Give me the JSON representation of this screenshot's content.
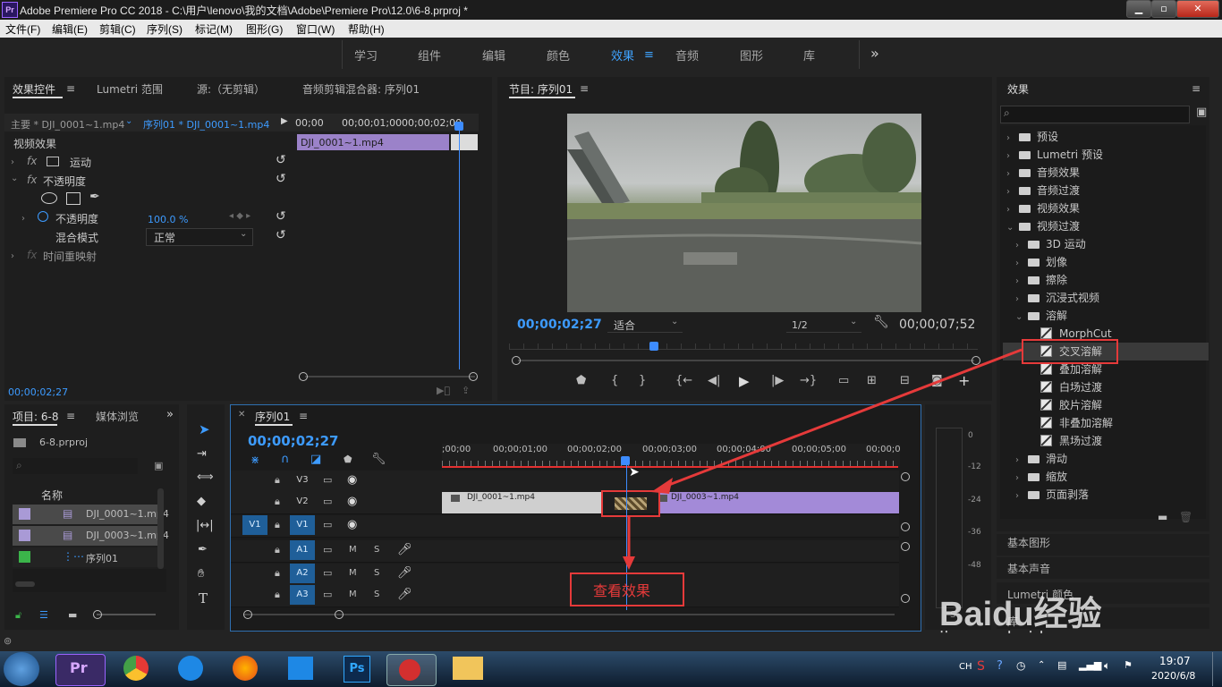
{
  "window": {
    "title": "Adobe Premiere Pro CC 2018 - C:\\用户\\lenovo\\我的文档\\Adobe\\Premiere Pro\\12.0\\6-8.prproj *",
    "logo": "Pr"
  },
  "menu": [
    "文件(F)",
    "编辑(E)",
    "剪辑(C)",
    "序列(S)",
    "标记(M)",
    "图形(G)",
    "窗口(W)",
    "帮助(H)"
  ],
  "workspaces": [
    "学习",
    "组件",
    "编辑",
    "颜色",
    "效果",
    "音频",
    "图形",
    "库"
  ],
  "workspace_active": "效果",
  "workspace_more": "»",
  "effect_controls": {
    "tabs": [
      "效果控件",
      "Lumetri 范围",
      "源:（无剪辑）",
      "音频剪辑混合器: 序列01"
    ],
    "master_label": "主要 * DJI_0001~1.mp4",
    "sequence_label": "序列01 * DJI_0001~1.mp4",
    "ruler": [
      "00;00",
      "00;00;01;00",
      "00;00;02;00"
    ],
    "clip": "DJI_0001~1.mp4",
    "section": "视频效果",
    "motion": "运动",
    "opacity": "不透明度",
    "opacity_param": "不透明度",
    "opacity_value": "100.0 %",
    "blend_mode_label": "混合模式",
    "blend_mode_value": "正常",
    "time_remap": "时间重映射",
    "timecode": "00;00;02;27"
  },
  "program": {
    "tab": "节目: 序列01",
    "timecode": "00;00;02;27",
    "fit": "适合",
    "resolution": "1/2",
    "duration": "00;00;07;52"
  },
  "effects_panel": {
    "title": "效果",
    "tree": [
      {
        "label": "预设",
        "level": 0,
        "kind": "folder",
        "open": false
      },
      {
        "label": "Lumetri 预设",
        "level": 0,
        "kind": "folder",
        "open": false
      },
      {
        "label": "音频效果",
        "level": 0,
        "kind": "folder",
        "open": false
      },
      {
        "label": "音频过渡",
        "level": 0,
        "kind": "folder",
        "open": false
      },
      {
        "label": "视频效果",
        "level": 0,
        "kind": "folder",
        "open": false
      },
      {
        "label": "视频过渡",
        "level": 0,
        "kind": "folder",
        "open": true
      },
      {
        "label": "3D 运动",
        "level": 1,
        "kind": "folder",
        "open": false
      },
      {
        "label": "划像",
        "level": 1,
        "kind": "folder",
        "open": false
      },
      {
        "label": "擦除",
        "level": 1,
        "kind": "folder",
        "open": false
      },
      {
        "label": "沉浸式视频",
        "level": 1,
        "kind": "folder",
        "open": false
      },
      {
        "label": "溶解",
        "level": 1,
        "kind": "folder",
        "open": true
      },
      {
        "label": "MorphCut",
        "level": 2,
        "kind": "effect"
      },
      {
        "label": "交叉溶解",
        "level": 2,
        "kind": "effect",
        "selected": true
      },
      {
        "label": "叠加溶解",
        "level": 2,
        "kind": "effect"
      },
      {
        "label": "白场过渡",
        "level": 2,
        "kind": "effect"
      },
      {
        "label": "胶片溶解",
        "level": 2,
        "kind": "effect"
      },
      {
        "label": "非叠加溶解",
        "level": 2,
        "kind": "effect"
      },
      {
        "label": "黑场过渡",
        "level": 2,
        "kind": "effect"
      },
      {
        "label": "滑动",
        "level": 1,
        "kind": "folder",
        "open": false
      },
      {
        "label": "缩放",
        "level": 1,
        "kind": "folder",
        "open": false
      },
      {
        "label": "页面剥落",
        "level": 1,
        "kind": "folder",
        "open": false
      }
    ],
    "sections": [
      "基本图形",
      "基本声音",
      "Lumetri 颜色",
      "库"
    ]
  },
  "project": {
    "tabs": [
      "项目: 6-8",
      "媒体浏览"
    ],
    "file": "6-8.prproj",
    "column": "名称",
    "items": [
      {
        "name": "DJI_0001~1.mp4",
        "color": "#a99ad6"
      },
      {
        "name": "DJI_0003~1.mp4",
        "color": "#a99ad6"
      },
      {
        "name": "序列01",
        "color": "#3bb54a"
      }
    ]
  },
  "timeline": {
    "tab": "序列01",
    "timecode": "00;00;02;27",
    "ruler": [
      ";00;00",
      "00;00;01;00",
      "00;00;02;00",
      "00;00;03;00",
      "00;00;04;00",
      "00;00;05;00",
      "00;00;0"
    ],
    "video_tracks": [
      "V3",
      "V2",
      "V1"
    ],
    "source_patch": "V1",
    "audio_tracks": [
      "A1",
      "A2",
      "A3"
    ],
    "mute": "M",
    "solo": "S",
    "clip1": "DJI_0001~1.mp4",
    "clip2": "DJI_0003~1.mp4",
    "annotation": "查看效果"
  },
  "meter": {
    "ticks": [
      "0",
      "-12",
      "-24",
      "-36",
      "-48"
    ]
  },
  "watermark": {
    "brand": "Baidu经验",
    "url": "jingyan.baidu.com"
  },
  "taskbar": {
    "lang": "CH",
    "time": "19:07",
    "date": "2020/6/8"
  }
}
